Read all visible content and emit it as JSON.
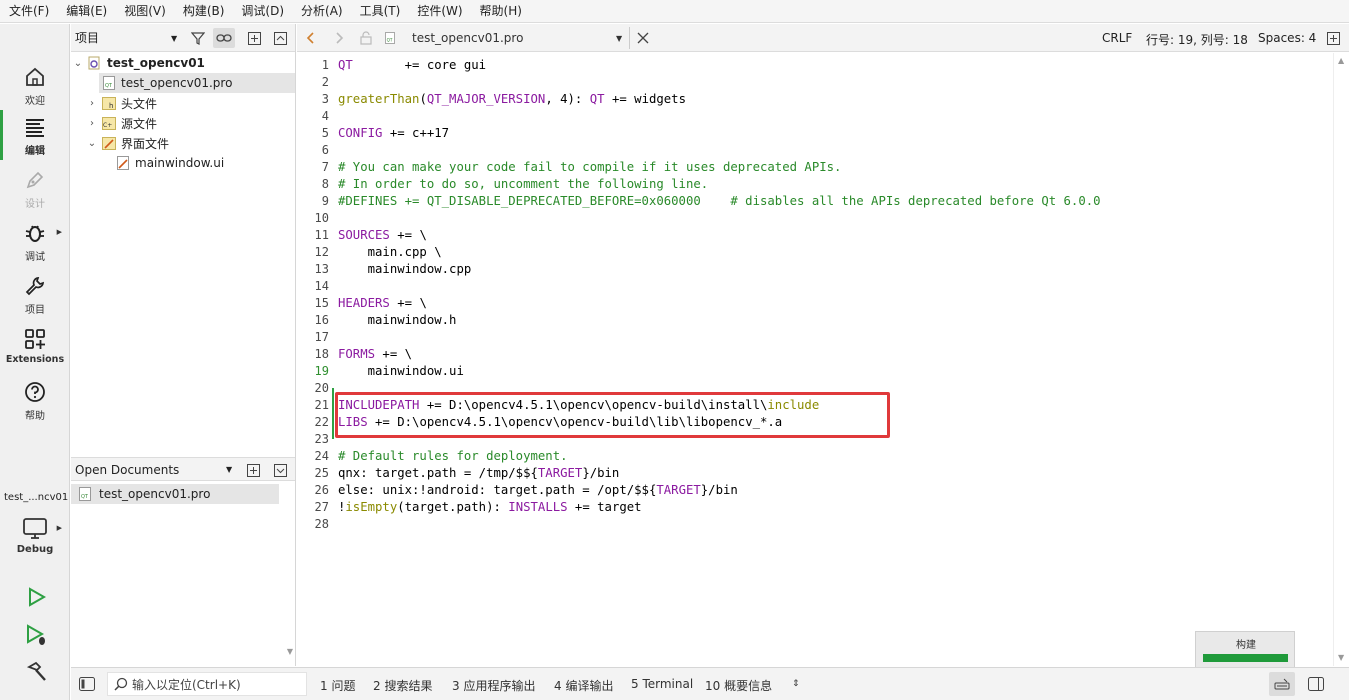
{
  "menu": [
    "文件(F)",
    "编辑(E)",
    "视图(V)",
    "构建(B)",
    "调试(D)",
    "分析(A)",
    "工具(T)",
    "控件(W)",
    "帮助(H)"
  ],
  "modes": [
    {
      "label": "欢迎",
      "icon": "home-icon",
      "active": false,
      "disabled": false
    },
    {
      "label": "编辑",
      "icon": "edit-lines-icon",
      "active": true,
      "disabled": false
    },
    {
      "label": "设计",
      "icon": "pen-icon",
      "active": false,
      "disabled": true
    },
    {
      "label": "调试",
      "icon": "bug-icon",
      "active": false,
      "disabled": false
    },
    {
      "label": "项目",
      "icon": "wrench-icon",
      "active": false,
      "disabled": false
    },
    {
      "label": "Extensions",
      "icon": "extensions-icon",
      "active": false,
      "disabled": false
    },
    {
      "label": "帮助",
      "icon": "help-icon",
      "active": false,
      "disabled": false
    }
  ],
  "kit": {
    "target": "test_...ncv01",
    "config": "Debug"
  },
  "project_pane": {
    "title": "项目",
    "tree": [
      {
        "label": "test_opencv01",
        "level": 0,
        "expanded": true,
        "bold": true,
        "icon": "project-icon"
      },
      {
        "label": "test_opencv01.pro",
        "level": 1,
        "selected": true,
        "icon": "pro-file-icon"
      },
      {
        "label": "头文件",
        "level": 1,
        "expanded": false,
        "icon": "header-folder-icon"
      },
      {
        "label": "源文件",
        "level": 1,
        "expanded": false,
        "icon": "source-folder-icon"
      },
      {
        "label": "界面文件",
        "level": 1,
        "expanded": true,
        "icon": "form-folder-icon"
      },
      {
        "label": "mainwindow.ui",
        "level": 2,
        "icon": "ui-file-icon"
      }
    ]
  },
  "open_documents": {
    "title": "Open Documents",
    "items": [
      "test_opencv01.pro"
    ]
  },
  "editor_toolbar": {
    "filename": "test_opencv01.pro",
    "line_ending": "CRLF",
    "position": "行号: 19, 列号: 18",
    "indent": "Spaces: 4"
  },
  "editor": {
    "current_line": 19,
    "lines": [
      [
        {
          "t": "QT       ",
          "c": "k"
        },
        {
          "t": "+= core gui"
        }
      ],
      [],
      [
        {
          "t": "greaterThan",
          "c": "f"
        },
        {
          "t": "("
        },
        {
          "t": "QT_MAJOR_VERSION",
          "c": "k"
        },
        {
          "t": ", 4): "
        },
        {
          "t": "QT",
          "c": "k"
        },
        {
          "t": " += widgets"
        }
      ],
      [],
      [
        {
          "t": "CONFIG",
          "c": "k"
        },
        {
          "t": " += c++17"
        }
      ],
      [],
      [
        {
          "t": "# You can make your code fail to compile if it uses deprecated APIs.",
          "c": "cm"
        }
      ],
      [
        {
          "t": "# In order to do so, uncomment the following line.",
          "c": "cm"
        }
      ],
      [
        {
          "t": "#DEFINES += QT_DISABLE_DEPRECATED_BEFORE=0x060000    # disables all the APIs deprecated before Qt 6.0.0",
          "c": "cm"
        }
      ],
      [],
      [
        {
          "t": "SOURCES",
          "c": "k"
        },
        {
          "t": " += \\"
        }
      ],
      [
        {
          "t": "    main.cpp \\"
        }
      ],
      [
        {
          "t": "    mainwindow.cpp"
        }
      ],
      [],
      [
        {
          "t": "HEADERS",
          "c": "k"
        },
        {
          "t": " += \\"
        }
      ],
      [
        {
          "t": "    mainwindow.h"
        }
      ],
      [],
      [
        {
          "t": "FORMS",
          "c": "k"
        },
        {
          "t": " += \\"
        }
      ],
      [
        {
          "t": "    mainwindow.ui"
        }
      ],
      [],
      [
        {
          "t": "INCLUDEPATH",
          "c": "k"
        },
        {
          "t": " += D:\\opencv4.5.1\\opencv\\opencv-build\\install\\"
        },
        {
          "t": "include",
          "c": "f"
        }
      ],
      [
        {
          "t": "LIBS",
          "c": "k"
        },
        {
          "t": " += D:\\opencv4.5.1\\opencv\\opencv-build\\lib\\libopencv_*.a"
        }
      ],
      [],
      [
        {
          "t": "# Default rules for deployment.",
          "c": "cm"
        }
      ],
      [
        {
          "t": "qnx: target.path = /tmp/$${"
        },
        {
          "t": "TARGET",
          "c": "k"
        },
        {
          "t": "}/bin"
        }
      ],
      [
        {
          "t": "else: unix:!android: target.path = /opt/$${"
        },
        {
          "t": "TARGET",
          "c": "k"
        },
        {
          "t": "}/bin"
        }
      ],
      [
        {
          "t": "!"
        },
        {
          "t": "isEmpty",
          "c": "f"
        },
        {
          "t": "(target.path): "
        },
        {
          "t": "INSTALLS",
          "c": "k"
        },
        {
          "t": " += target"
        }
      ],
      []
    ]
  },
  "build_progress": {
    "label": "构建",
    "progress": 1.0,
    "color": "#1f9a3a"
  },
  "bottom": {
    "locator_placeholder": "输入以定位(Ctrl+K)",
    "tabs": [
      "1  问题",
      "2  搜索结果",
      "3  应用程序输出",
      "4  编译输出",
      "5  Terminal",
      "10  概要信息"
    ]
  },
  "colors": {
    "keyword": "#8b1aa0",
    "function": "#8a8a00",
    "comment": "#2a8a2a",
    "highlight_box": "#e0393b",
    "active_mode": "#2ea043"
  }
}
